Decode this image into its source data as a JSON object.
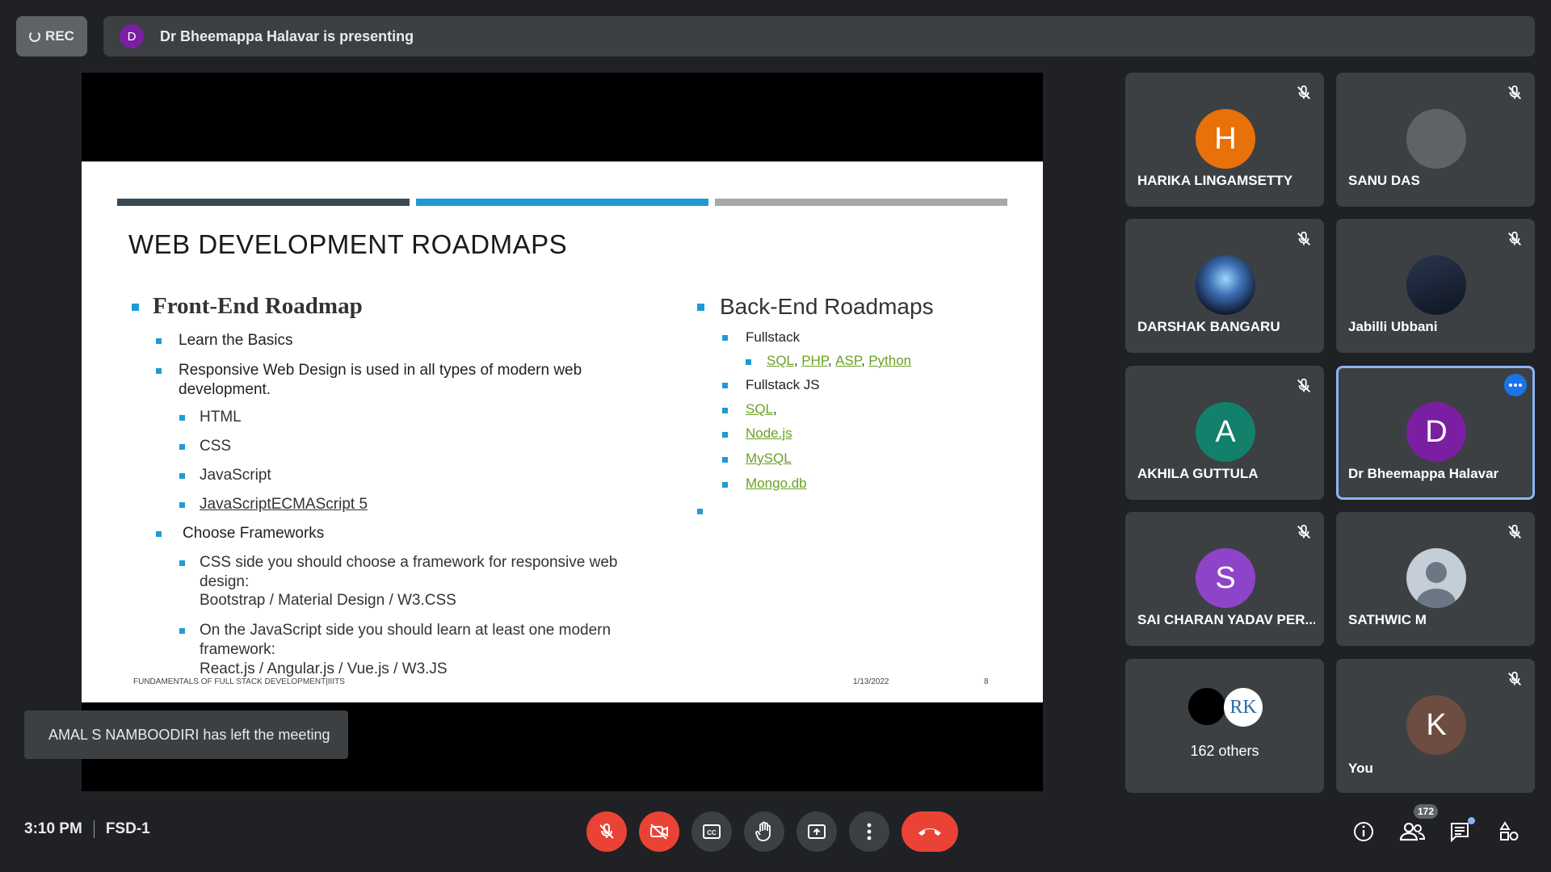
{
  "top": {
    "rec_label": "REC",
    "presenter_initial": "D",
    "presenting_text": "Dr Bheemappa Halavar is presenting"
  },
  "slide": {
    "title": "WEB DEVELOPMENT ROADMAPS",
    "left": {
      "heading": "Front-End Roadmap",
      "item1": "Learn the Basics",
      "item2_line1": "Responsive Web Design is used in all types of modern web",
      "item2_line2": "development.",
      "sub_html": "HTML",
      "sub_css": "CSS",
      "sub_js": "JavaScript",
      "sub_es5": "JavaScriptECMAScript 5",
      "item3": "Choose Frameworks",
      "fw1_line1": "CSS side you should choose a framework for responsive web",
      "fw1_line2": "design:",
      "fw1_line3": "Bootstrap  /  Material Design  /  W3.CSS",
      "fw2_line1": "On the JavaScript side you should learn at least one modern",
      "fw2_line2": "framework:",
      "fw2_line3": "React.js  /  Angular.js  /  Vue.js   /  W3.JS"
    },
    "right": {
      "heading": "Back-End Roadmaps",
      "fullstack": "Fullstack",
      "link_sql": "SQL",
      "link_php": "PHP",
      "link_asp": "ASP",
      "link_python": "Python",
      "comma": ",",
      "fullstack_js": "Fullstack JS",
      "link_sql2": "SQL",
      "link_node": "Node.js",
      "link_mysql": "MySQL",
      "link_mongo": "Mongo.db"
    },
    "footer_left": "FUNDAMENTALS OF FULL STACK DEVELOPMENT|IIITS",
    "footer_date": "1/13/2022",
    "footer_page": "8"
  },
  "participants": [
    {
      "name": "HARIKA LINGAMSETTY",
      "initial": "H",
      "color": "#e8710a"
    },
    {
      "name": "SANU DAS",
      "initial": "",
      "color": "#5f6368"
    },
    {
      "name": "DARSHAK BANGARU",
      "initial": "",
      "color": "#1b2a4a"
    },
    {
      "name": "Jabilli Ubbani",
      "initial": "",
      "color": "#1c2433"
    },
    {
      "name": "AKHILA GUTTULA",
      "initial": "A",
      "color": "#12806a"
    },
    {
      "name": "Dr Bheemappa Halavar",
      "initial": "D",
      "color": "#7b1fa2"
    },
    {
      "name": "SAI CHARAN YADAV PER...",
      "initial": "S",
      "color": "#8e44c8"
    },
    {
      "name": "SATHWIC M",
      "initial": "",
      "color": "#c5cdd6"
    },
    {
      "name": "162 others",
      "initial": "",
      "color": "#000000"
    },
    {
      "name": "You",
      "initial": "K",
      "color": "#6d4c41"
    }
  ],
  "others_rk_label": "RK",
  "toast": "AMAL S NAMBOODIRI has left the meeting",
  "bottom": {
    "time": "3:10 PM",
    "meeting_name": "FSD-1",
    "participant_count": "172"
  }
}
